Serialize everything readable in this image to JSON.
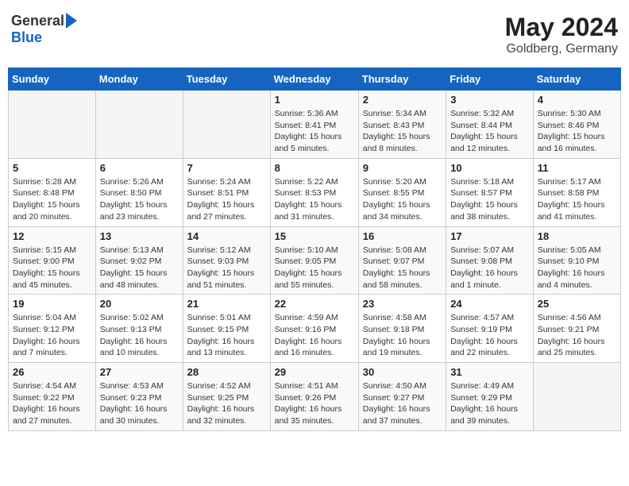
{
  "header": {
    "logo_general": "General",
    "logo_blue": "Blue",
    "month": "May 2024",
    "location": "Goldberg, Germany"
  },
  "weekdays": [
    "Sunday",
    "Monday",
    "Tuesday",
    "Wednesday",
    "Thursday",
    "Friday",
    "Saturday"
  ],
  "weeks": [
    [
      {
        "day": "",
        "info": ""
      },
      {
        "day": "",
        "info": ""
      },
      {
        "day": "",
        "info": ""
      },
      {
        "day": "1",
        "info": "Sunrise: 5:36 AM\nSunset: 8:41 PM\nDaylight: 15 hours\nand 5 minutes."
      },
      {
        "day": "2",
        "info": "Sunrise: 5:34 AM\nSunset: 8:43 PM\nDaylight: 15 hours\nand 8 minutes."
      },
      {
        "day": "3",
        "info": "Sunrise: 5:32 AM\nSunset: 8:44 PM\nDaylight: 15 hours\nand 12 minutes."
      },
      {
        "day": "4",
        "info": "Sunrise: 5:30 AM\nSunset: 8:46 PM\nDaylight: 15 hours\nand 16 minutes."
      }
    ],
    [
      {
        "day": "5",
        "info": "Sunrise: 5:28 AM\nSunset: 8:48 PM\nDaylight: 15 hours\nand 20 minutes."
      },
      {
        "day": "6",
        "info": "Sunrise: 5:26 AM\nSunset: 8:50 PM\nDaylight: 15 hours\nand 23 minutes."
      },
      {
        "day": "7",
        "info": "Sunrise: 5:24 AM\nSunset: 8:51 PM\nDaylight: 15 hours\nand 27 minutes."
      },
      {
        "day": "8",
        "info": "Sunrise: 5:22 AM\nSunset: 8:53 PM\nDaylight: 15 hours\nand 31 minutes."
      },
      {
        "day": "9",
        "info": "Sunrise: 5:20 AM\nSunset: 8:55 PM\nDaylight: 15 hours\nand 34 minutes."
      },
      {
        "day": "10",
        "info": "Sunrise: 5:18 AM\nSunset: 8:57 PM\nDaylight: 15 hours\nand 38 minutes."
      },
      {
        "day": "11",
        "info": "Sunrise: 5:17 AM\nSunset: 8:58 PM\nDaylight: 15 hours\nand 41 minutes."
      }
    ],
    [
      {
        "day": "12",
        "info": "Sunrise: 5:15 AM\nSunset: 9:00 PM\nDaylight: 15 hours\nand 45 minutes."
      },
      {
        "day": "13",
        "info": "Sunrise: 5:13 AM\nSunset: 9:02 PM\nDaylight: 15 hours\nand 48 minutes."
      },
      {
        "day": "14",
        "info": "Sunrise: 5:12 AM\nSunset: 9:03 PM\nDaylight: 15 hours\nand 51 minutes."
      },
      {
        "day": "15",
        "info": "Sunrise: 5:10 AM\nSunset: 9:05 PM\nDaylight: 15 hours\nand 55 minutes."
      },
      {
        "day": "16",
        "info": "Sunrise: 5:08 AM\nSunset: 9:07 PM\nDaylight: 15 hours\nand 58 minutes."
      },
      {
        "day": "17",
        "info": "Sunrise: 5:07 AM\nSunset: 9:08 PM\nDaylight: 16 hours\nand 1 minute."
      },
      {
        "day": "18",
        "info": "Sunrise: 5:05 AM\nSunset: 9:10 PM\nDaylight: 16 hours\nand 4 minutes."
      }
    ],
    [
      {
        "day": "19",
        "info": "Sunrise: 5:04 AM\nSunset: 9:12 PM\nDaylight: 16 hours\nand 7 minutes."
      },
      {
        "day": "20",
        "info": "Sunrise: 5:02 AM\nSunset: 9:13 PM\nDaylight: 16 hours\nand 10 minutes."
      },
      {
        "day": "21",
        "info": "Sunrise: 5:01 AM\nSunset: 9:15 PM\nDaylight: 16 hours\nand 13 minutes."
      },
      {
        "day": "22",
        "info": "Sunrise: 4:59 AM\nSunset: 9:16 PM\nDaylight: 16 hours\nand 16 minutes."
      },
      {
        "day": "23",
        "info": "Sunrise: 4:58 AM\nSunset: 9:18 PM\nDaylight: 16 hours\nand 19 minutes."
      },
      {
        "day": "24",
        "info": "Sunrise: 4:57 AM\nSunset: 9:19 PM\nDaylight: 16 hours\nand 22 minutes."
      },
      {
        "day": "25",
        "info": "Sunrise: 4:56 AM\nSunset: 9:21 PM\nDaylight: 16 hours\nand 25 minutes."
      }
    ],
    [
      {
        "day": "26",
        "info": "Sunrise: 4:54 AM\nSunset: 9:22 PM\nDaylight: 16 hours\nand 27 minutes."
      },
      {
        "day": "27",
        "info": "Sunrise: 4:53 AM\nSunset: 9:23 PM\nDaylight: 16 hours\nand 30 minutes."
      },
      {
        "day": "28",
        "info": "Sunrise: 4:52 AM\nSunset: 9:25 PM\nDaylight: 16 hours\nand 32 minutes."
      },
      {
        "day": "29",
        "info": "Sunrise: 4:51 AM\nSunset: 9:26 PM\nDaylight: 16 hours\nand 35 minutes."
      },
      {
        "day": "30",
        "info": "Sunrise: 4:50 AM\nSunset: 9:27 PM\nDaylight: 16 hours\nand 37 minutes."
      },
      {
        "day": "31",
        "info": "Sunrise: 4:49 AM\nSunset: 9:29 PM\nDaylight: 16 hours\nand 39 minutes."
      },
      {
        "day": "",
        "info": ""
      }
    ]
  ]
}
